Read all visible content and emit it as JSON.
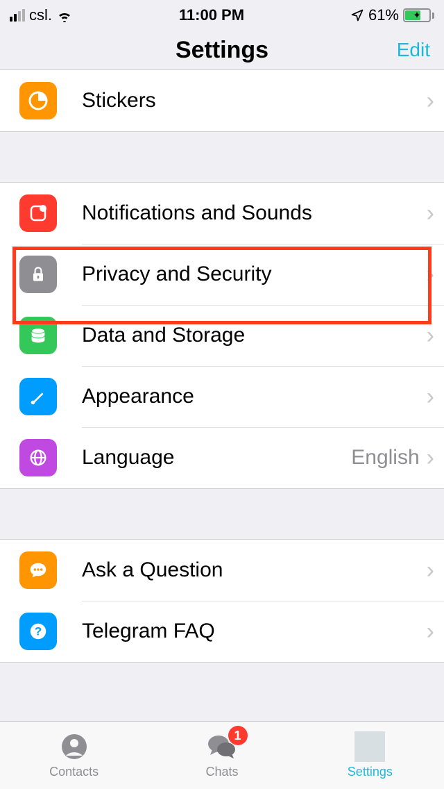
{
  "status": {
    "carrier": "csl.",
    "time": "11:00 PM",
    "battery_pct": "61%"
  },
  "header": {
    "title": "Settings",
    "edit": "Edit"
  },
  "groups": {
    "g1": [
      {
        "label": "Stickers",
        "icon": "stickers",
        "bg": "#ff9500"
      }
    ],
    "g2": [
      {
        "label": "Notifications and Sounds",
        "icon": "notifications",
        "bg": "#ff3b30"
      },
      {
        "label": "Privacy and Security",
        "icon": "lock",
        "bg": "#8e8e93"
      },
      {
        "label": "Data and Storage",
        "icon": "storage",
        "bg": "#34c759"
      },
      {
        "label": "Appearance",
        "icon": "brush",
        "bg": "#009dff"
      },
      {
        "label": "Language",
        "icon": "globe",
        "bg": "#c049e2",
        "value": "English"
      }
    ],
    "g3": [
      {
        "label": "Ask a Question",
        "icon": "chat",
        "bg": "#ff9500"
      },
      {
        "label": "Telegram FAQ",
        "icon": "help",
        "bg": "#009dff"
      }
    ]
  },
  "tabs": {
    "contacts": "Contacts",
    "chats": "Chats",
    "chats_badge": "1",
    "settings": "Settings"
  },
  "highlight_row": "privacy"
}
